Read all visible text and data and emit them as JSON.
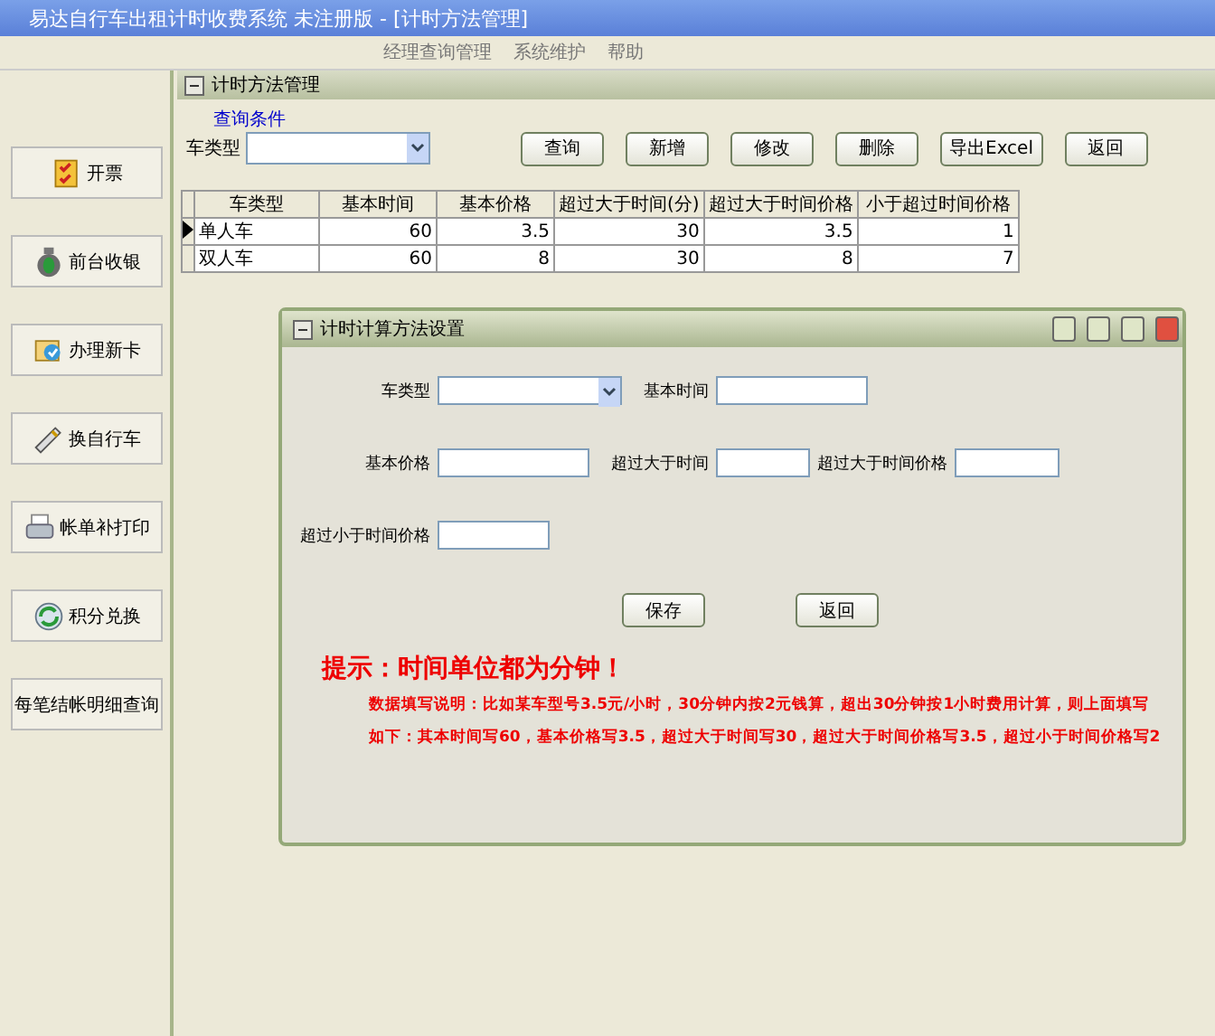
{
  "window": {
    "title": "易达自行车出租计时收费系统 未注册版 - [计时方法管理]"
  },
  "menu": [
    "经理查询管理",
    "系统维护",
    "帮助"
  ],
  "sidebar": [
    {
      "label": "开票",
      "kind": "checklist"
    },
    {
      "label": "前台收银",
      "kind": "moneybag"
    },
    {
      "label": "办理新卡",
      "kind": "card"
    },
    {
      "label": "换自行车",
      "kind": "pen"
    },
    {
      "label": "帐单补打印",
      "kind": "printer"
    },
    {
      "label": "积分兑换",
      "kind": "refresh"
    },
    {
      "label": "每笔结帐明细查询",
      "kind": "plain"
    }
  ],
  "panel": {
    "title": "计时方法管理",
    "group": "查询条件",
    "filter_label": "车类型",
    "buttons": [
      "查询",
      "新增",
      "修改",
      "删除",
      "导出Excel",
      "返回"
    ]
  },
  "table": {
    "columns": [
      "车类型",
      "基本时间",
      "基本价格",
      "超过大于时间(分)",
      "超过大于时间价格",
      "小于超过时间价格"
    ],
    "rows": [
      {
        "cells": [
          "单人车",
          "60",
          "3.5",
          "30",
          "3.5",
          "1"
        ],
        "selected": true
      },
      {
        "cells": [
          "双人车",
          "60",
          "8",
          "30",
          "8",
          "7"
        ],
        "selected": false
      }
    ]
  },
  "dialog": {
    "title": "计时计算方法设置",
    "fields": [
      {
        "label": "车类型",
        "kind": "select"
      },
      {
        "label": "基本时间",
        "kind": "text"
      },
      {
        "label": "基本价格",
        "kind": "text"
      },
      {
        "label": "超过大于时间",
        "kind": "text"
      },
      {
        "label": "超过大于时间价格",
        "kind": "text"
      },
      {
        "label": "超过小于时间价格",
        "kind": "text"
      }
    ],
    "buttons": [
      "保存",
      "返回"
    ],
    "hint": "提示：时间单位都为分钟！",
    "note_lines": [
      "数据填写说明：比如某车型号3.5元/小时，30分钟内按2元钱算，超出30分钟按1小时费用计算，则上面填写",
      "如下：其本时间写60，基本价格写3.5，超过大于时间写30，超过大于时间价格写3.5，超过小于时间价格写2"
    ]
  }
}
